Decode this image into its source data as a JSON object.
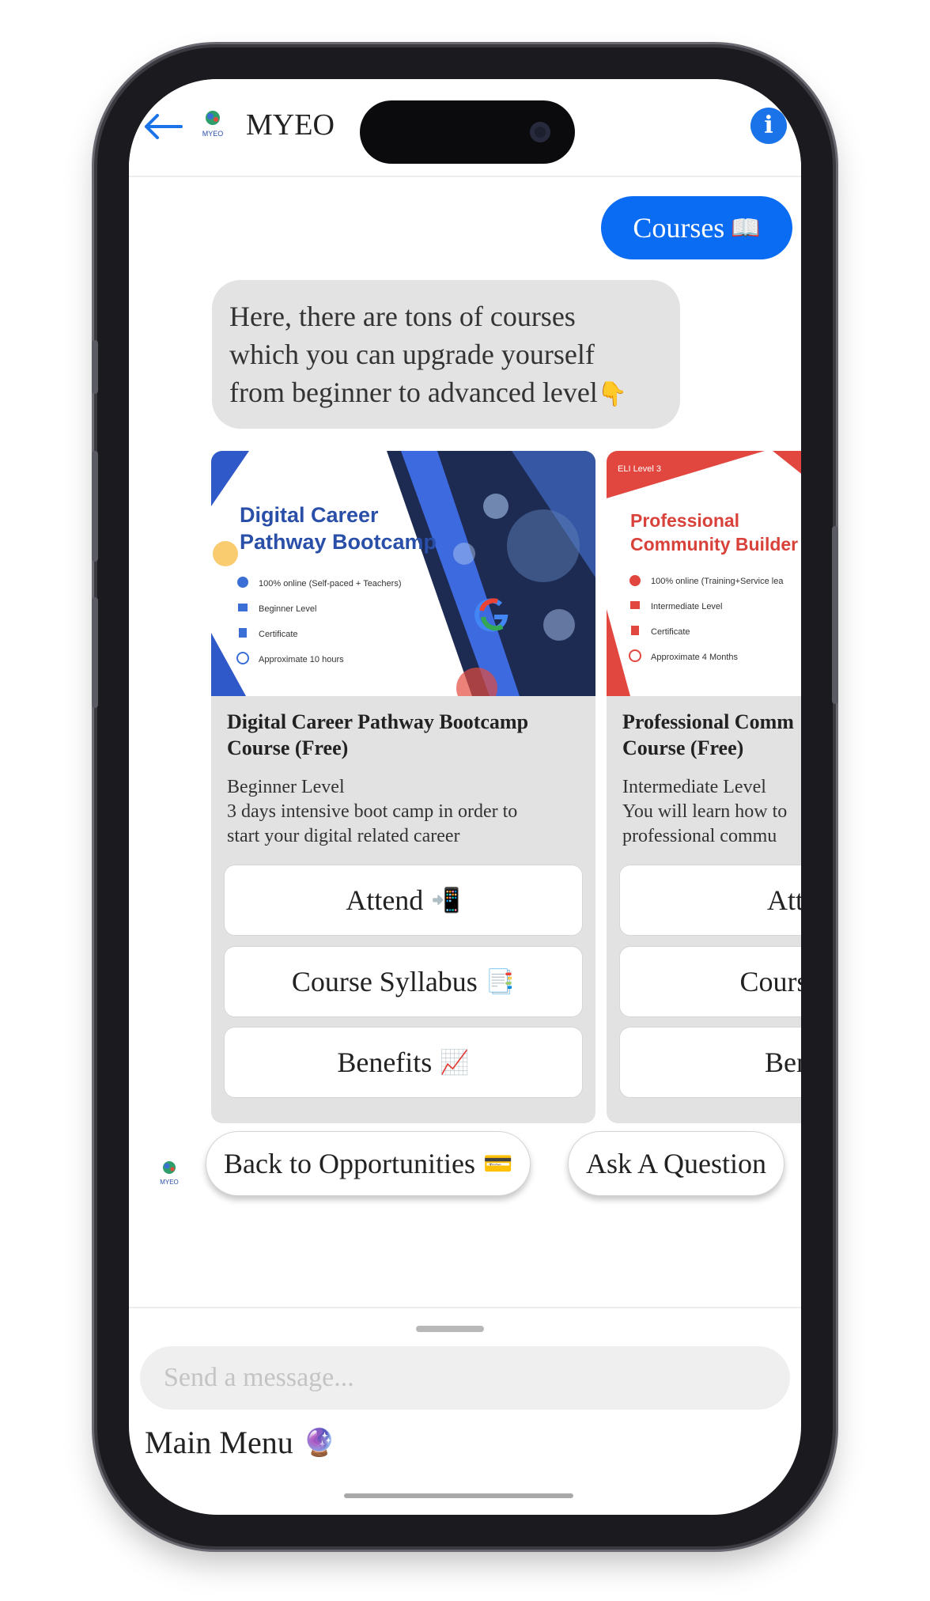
{
  "header": {
    "title": "MYEO",
    "logo_text": "MYEO"
  },
  "chat": {
    "user_message": "Courses",
    "user_message_emoji": "📖",
    "bot_message_lines": [
      "Here, there are tons of courses",
      "which you can upgrade yourself",
      "from beginner to advanced level"
    ],
    "bot_message_emoji": "👇"
  },
  "cards": [
    {
      "image_title_line1": "Digital Career",
      "image_title_line2": "Pathway Bootcamp",
      "image_bullets": [
        "100% online (Self-paced + Teachers)",
        "Beginner Level",
        "Certificate",
        "Approximate 10 hours"
      ],
      "title_line1": "Digital Career Pathway Bootcamp",
      "title_line2": "Course (Free)",
      "level": "Beginner Level",
      "desc_line1": "3 days intensive boot camp in order to",
      "desc_line2": "start your digital related career",
      "buttons": [
        {
          "label": "Attend",
          "emoji": "📲"
        },
        {
          "label": "Course Syllabus",
          "emoji": "📑"
        },
        {
          "label": "Benefits",
          "emoji": "📈"
        }
      ]
    },
    {
      "image_tag": "ELI Level 3",
      "image_title_line1": "Professional",
      "image_title_line2": "Community Builder",
      "image_bullets": [
        "100% online (Training+Service lea",
        "Intermediate Level",
        "Certificate",
        "Approximate 4 Months"
      ],
      "title_line1": "Professional Comm",
      "title_line2": "Course (Free)",
      "level": "Intermediate Level",
      "desc_line1": "You will learn how to",
      "desc_line2": "professional commu",
      "buttons": [
        {
          "label": "Atten",
          "emoji": ""
        },
        {
          "label": "Course Sy",
          "emoji": ""
        },
        {
          "label": "Benef",
          "emoji": ""
        }
      ]
    }
  ],
  "quick_replies": [
    {
      "label": "Back to Opportunities",
      "emoji": "💳"
    },
    {
      "label": "Ask A Question",
      "emoji": ""
    }
  ],
  "composer": {
    "placeholder": "Send a message..."
  },
  "main_menu": {
    "label": "Main Menu",
    "emoji": "🔮"
  },
  "colors": {
    "accent": "#0a6cf2",
    "bubble_gray": "#e3e3e3",
    "card_gray": "#e2e2e2"
  }
}
